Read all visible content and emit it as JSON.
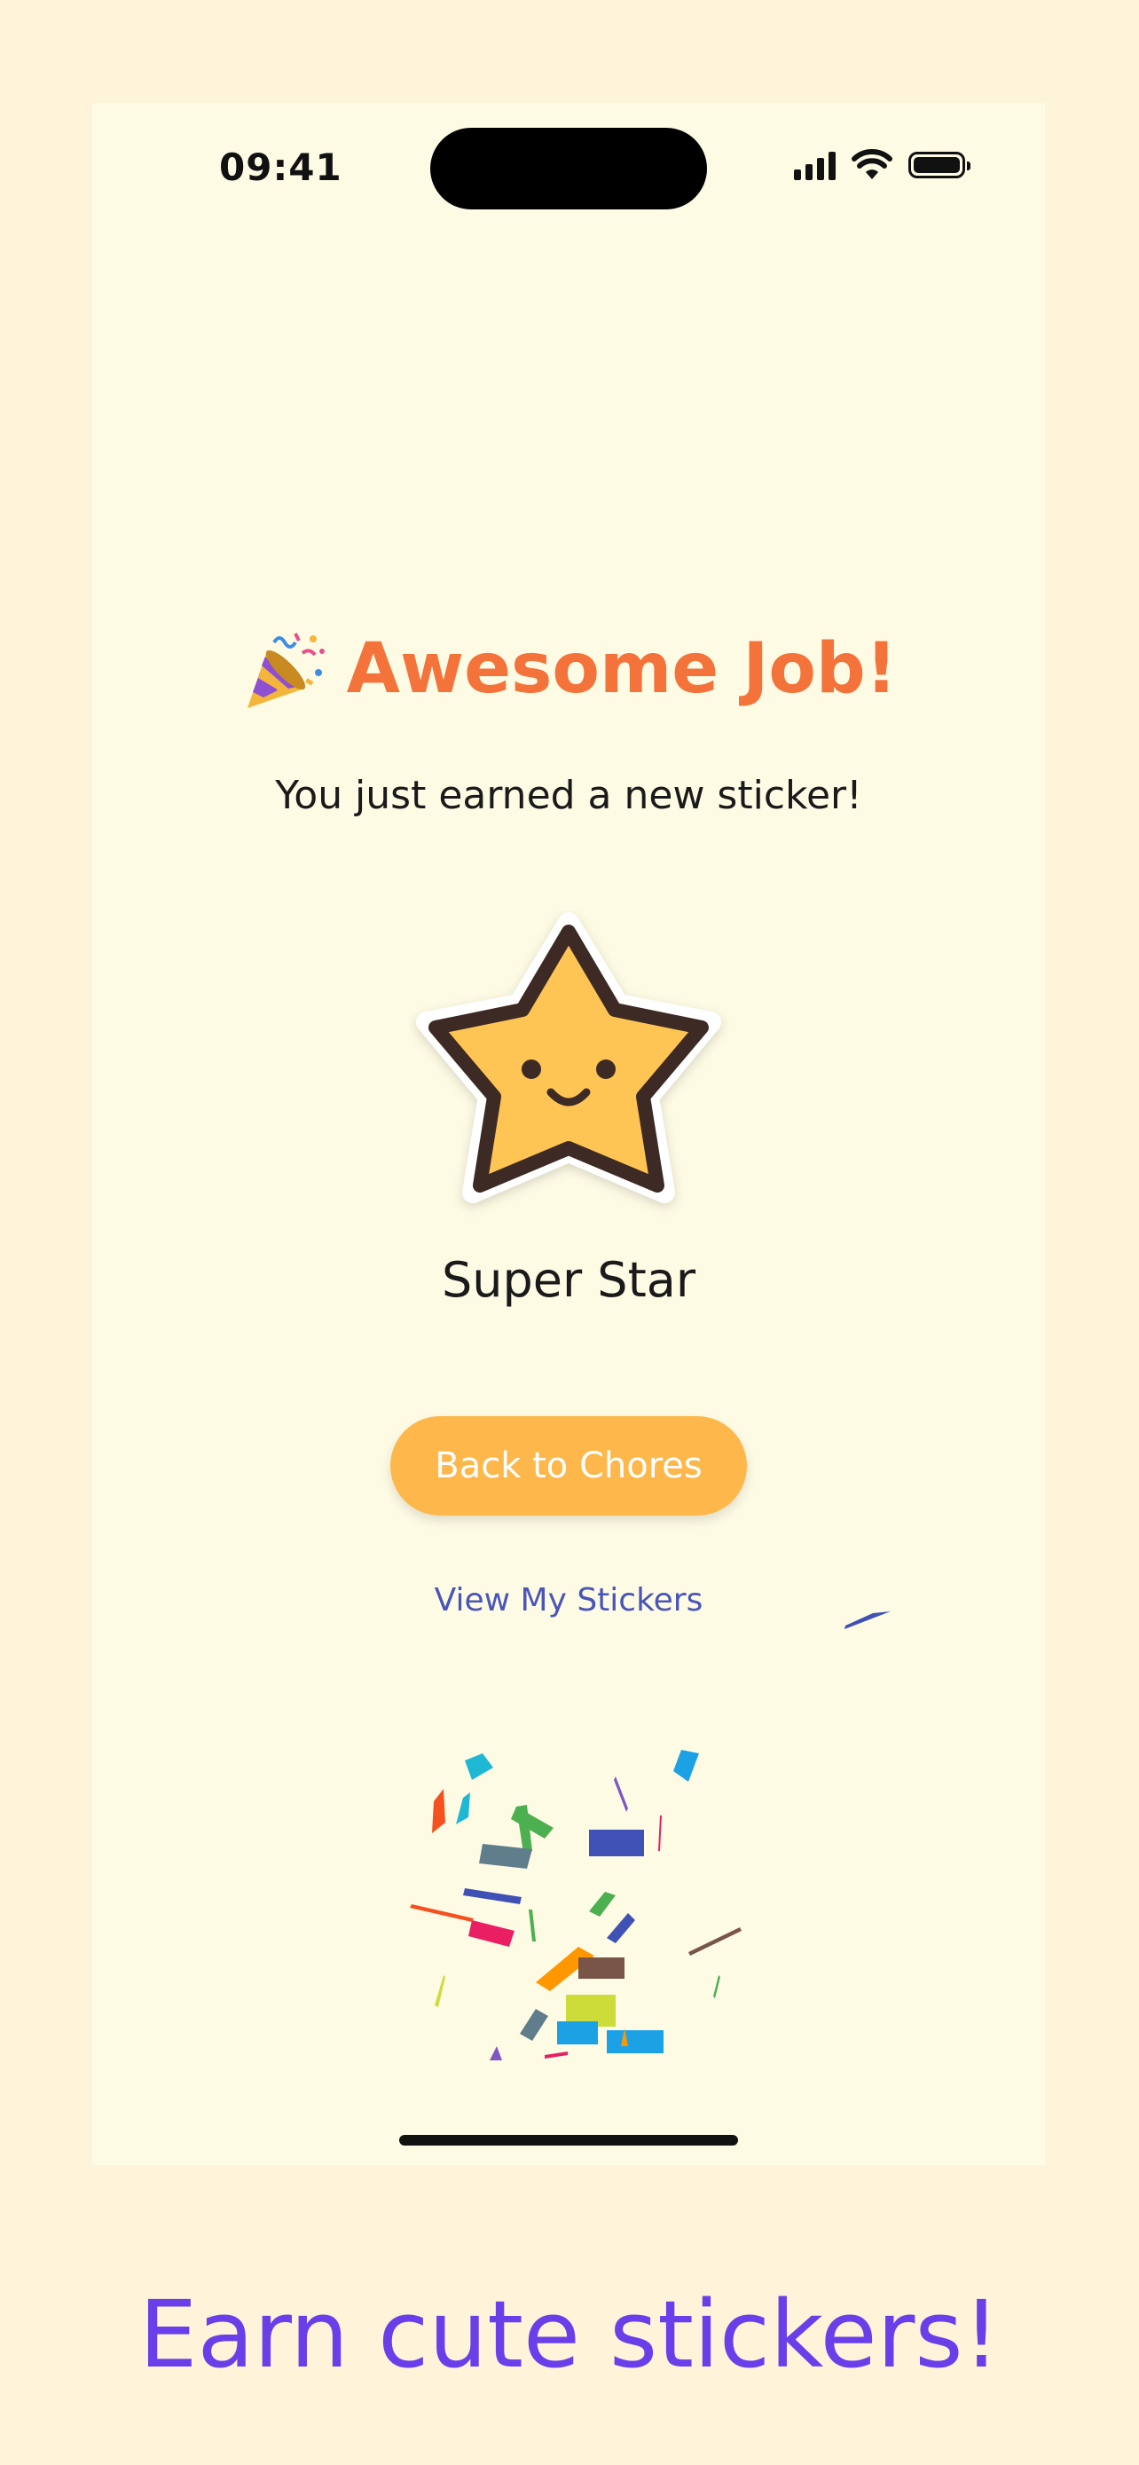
{
  "status_bar": {
    "time": "09:41"
  },
  "celebration": {
    "title": "Awesome Job!",
    "party_icon": "party-popper",
    "subtitle": "You just earned a new sticker!",
    "sticker_name": "Super Star",
    "sticker_icon": "smiling-star"
  },
  "actions": {
    "primary_label": "Back to Chores",
    "secondary_label": "View My Stickers"
  },
  "caption": "Earn cute stickers!",
  "colors": {
    "title": "#F4733A",
    "primary_button": "#FEB74A",
    "link": "#4955B8",
    "caption": "#6A3FEA",
    "background": "#FDF4D9",
    "screen": "#FEFBE5"
  }
}
